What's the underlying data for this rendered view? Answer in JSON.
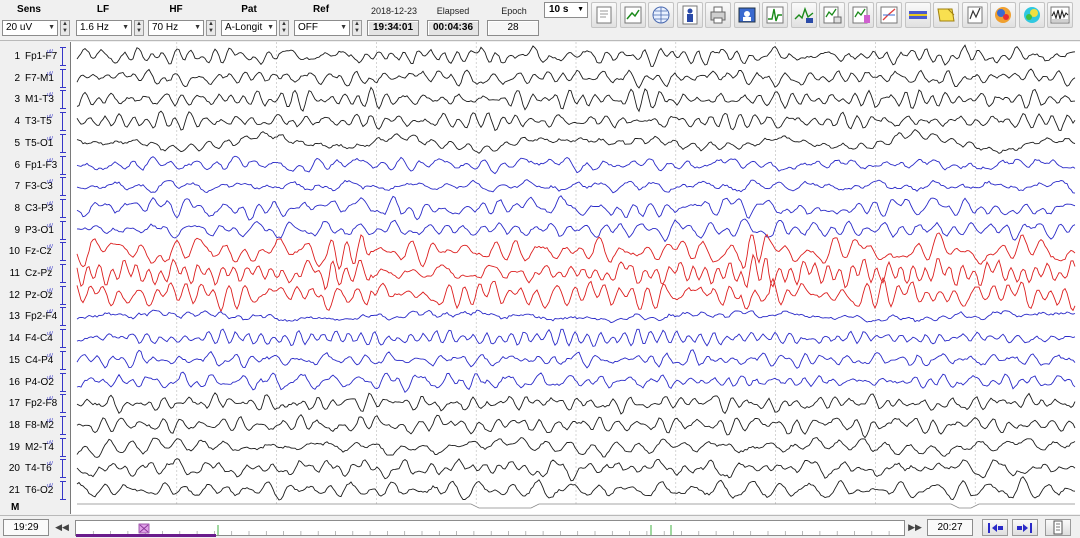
{
  "controls": {
    "sens": {
      "label": "Sens",
      "value": "20 uV"
    },
    "lf": {
      "label": "LF",
      "value": "1.6 Hz"
    },
    "hf": {
      "label": "HF",
      "value": "70 Hz"
    },
    "pat": {
      "label": "Pat",
      "value": "A-Longit"
    },
    "ref": {
      "label": "Ref",
      "value": "OFF"
    }
  },
  "info": {
    "date": "2018-12-23",
    "clock": "19:34:01",
    "elapsed_label": "Elapsed",
    "elapsed": "00:04:36",
    "epoch_label": "Epoch",
    "epoch": "28"
  },
  "duration": "10 s",
  "toolbar_icons": [
    "save-icon",
    "montage-edit-icon",
    "map-globe-icon",
    "patient-info-icon",
    "print-icon",
    "picture-icon",
    "spike-detect-icon",
    "waveform-edit-icon",
    "report-icon",
    "marker-icon",
    "trend-icon",
    "spectrum-band-icon",
    "note-icon",
    "analysis-icon",
    "head-map-icon",
    "color-map-icon",
    "wave-analysis-icon"
  ],
  "channels": [
    {
      "num": "1",
      "name": "Fp1-F7",
      "color": "#1c1c1c"
    },
    {
      "num": "2",
      "name": "F7-M1",
      "color": "#1c1c1c"
    },
    {
      "num": "3",
      "name": "M1-T3",
      "color": "#1c1c1c"
    },
    {
      "num": "4",
      "name": "T3-T5",
      "color": "#1c1c1c"
    },
    {
      "num": "5",
      "name": "T5-O1",
      "color": "#1c1c1c"
    },
    {
      "num": "6",
      "name": "Fp1-F3",
      "color": "#2a2ac8"
    },
    {
      "num": "7",
      "name": "F3-C3",
      "color": "#2a2ac8"
    },
    {
      "num": "8",
      "name": "C3-P3",
      "color": "#2a2ac8"
    },
    {
      "num": "9",
      "name": "P3-O1",
      "color": "#2a2ac8"
    },
    {
      "num": "10",
      "name": "Fz-Cz",
      "color": "#dc1e1e"
    },
    {
      "num": "11",
      "name": "Cz-Pz",
      "color": "#dc1e1e"
    },
    {
      "num": "12",
      "name": "Pz-Oz",
      "color": "#dc1e1e"
    },
    {
      "num": "13",
      "name": "Fp2-F4",
      "color": "#2a2ac8"
    },
    {
      "num": "14",
      "name": "F4-C4",
      "color": "#2a2ac8"
    },
    {
      "num": "15",
      "name": "C4-P4",
      "color": "#2a2ac8"
    },
    {
      "num": "16",
      "name": "P4-O2",
      "color": "#2a2ac8"
    },
    {
      "num": "17",
      "name": "Fp2-F8",
      "color": "#1c1c1c"
    },
    {
      "num": "18",
      "name": "F8-M2",
      "color": "#1c1c1c"
    },
    {
      "num": "19",
      "name": "M2-T4",
      "color": "#1c1c1c"
    },
    {
      "num": "20",
      "name": "T4-T6",
      "color": "#1c1c1c"
    },
    {
      "num": "21",
      "name": "T6-O2",
      "color": "#1c1c1c"
    }
  ],
  "scale_unit": "uV",
  "marker_channel": "M",
  "timeline": {
    "start": "19:29",
    "end": "20:27"
  }
}
